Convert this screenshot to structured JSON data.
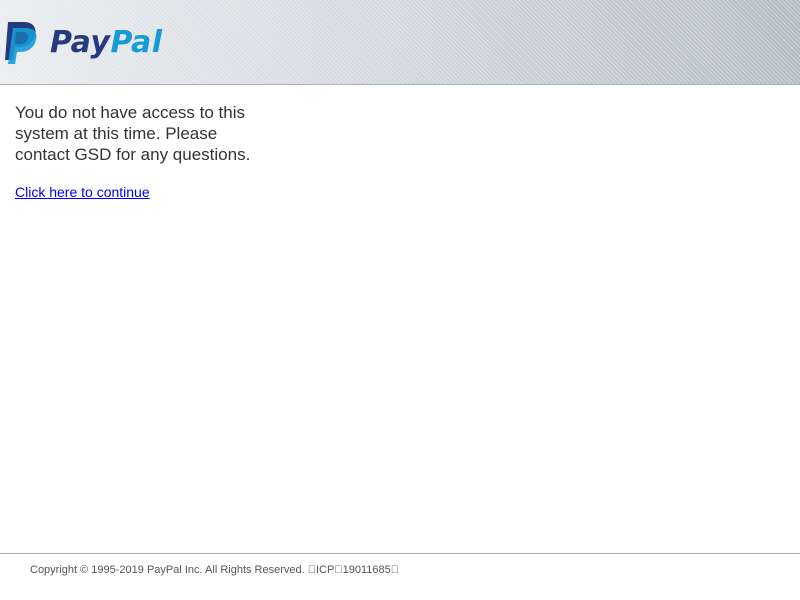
{
  "header": {
    "logo_alt": "PayPal",
    "logo_word_1": "Pay",
    "logo_word_2": "Pal",
    "colors": {
      "pay": "#253b80",
      "pal": "#179bd7"
    }
  },
  "main": {
    "message": "You do not have access to this system at this time. Please contact GSD for any questions.",
    "continue_link": "Click here to continue"
  },
  "footer": {
    "copyright": "Copyright © 1995-2019 PayPal Inc. All Rights Reserved. \u0000ICP\u000019011685\u0000"
  }
}
